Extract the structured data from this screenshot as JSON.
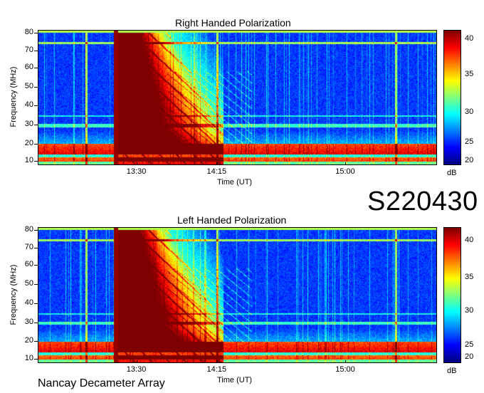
{
  "event_id": "S220430",
  "credit": "Nancay Decameter Array",
  "chart_data": [
    {
      "type": "heatmap",
      "title": "Right Handed Polarization",
      "xlabel": "Time (UT)",
      "ylabel": "Frequency (MHz)",
      "x_ticks": [
        "13:30",
        "14:15",
        "15:00"
      ],
      "y_ticks": [
        "80",
        "70",
        "60",
        "50",
        "40",
        "30",
        "20",
        "10"
      ],
      "y_range": [
        10,
        80
      ],
      "colorbar": {
        "label": "dB",
        "ticks": [
          "40",
          "35",
          "30",
          "25",
          "20"
        ],
        "range": [
          18.5,
          41.5
        ]
      },
      "x_range_ut": [
        "13:13",
        "15:23"
      ]
    },
    {
      "type": "heatmap",
      "title": "Left Handed Polarization",
      "xlabel": "Time (UT)",
      "ylabel": "Frequency (MHz)",
      "x_ticks": [
        "13:30",
        "14:15",
        "15:00"
      ],
      "y_ticks": [
        "80",
        "70",
        "60",
        "50",
        "40",
        "30",
        "20",
        "10"
      ],
      "y_range": [
        10,
        80
      ],
      "colorbar": {
        "label": "dB",
        "ticks": [
          "40",
          "35",
          "30",
          "25",
          "20"
        ],
        "range": [
          17.5,
          42.5
        ]
      },
      "x_range_ut": [
        "13:13",
        "15:23"
      ]
    }
  ]
}
